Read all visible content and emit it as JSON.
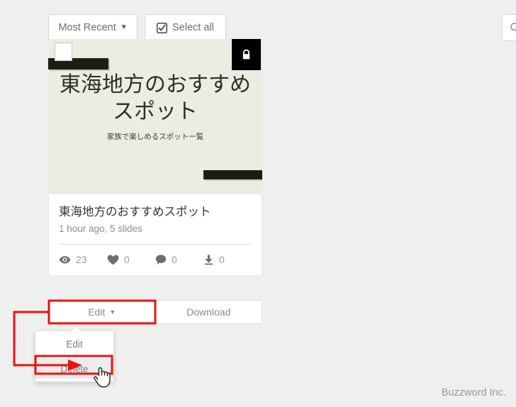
{
  "toolbar": {
    "sort_label": "Most Recent",
    "sort_caret": "▼",
    "select_all_label": "Select all",
    "select_all_icon": "checkbox-check-icon"
  },
  "search": {
    "icon": "search-icon",
    "placeholder": ""
  },
  "card": {
    "thumbnail": {
      "checkbox_icon": "select-checkbox",
      "lock_icon": "lock-icon",
      "slide_title": "東海地方のおすすめスポット",
      "slide_subtitle": "家族で楽しめるスポット一覧",
      "bg_color": "#edece4",
      "bar_color": "#1d1d13"
    },
    "title": "東海地方のおすすめスポット",
    "meta": "1 hour ago, 5 slides",
    "stats": [
      {
        "icon": "eye-icon",
        "value": "23"
      },
      {
        "icon": "heart-icon",
        "value": "0"
      },
      {
        "icon": "comment-icon",
        "value": "0"
      },
      {
        "icon": "download-icon",
        "value": "0"
      }
    ]
  },
  "actions": {
    "edit_label": "Edit",
    "edit_caret": "▼",
    "download_label": "Download"
  },
  "dropdown": {
    "items": [
      {
        "label": "Edit",
        "active": false
      },
      {
        "label": "Delete",
        "active": true
      }
    ]
  },
  "annotation": {
    "color": "#ee1111",
    "highlight_edit_button": true,
    "highlight_delete_item": true
  },
  "footer": {
    "text": "Buzzword Inc."
  }
}
